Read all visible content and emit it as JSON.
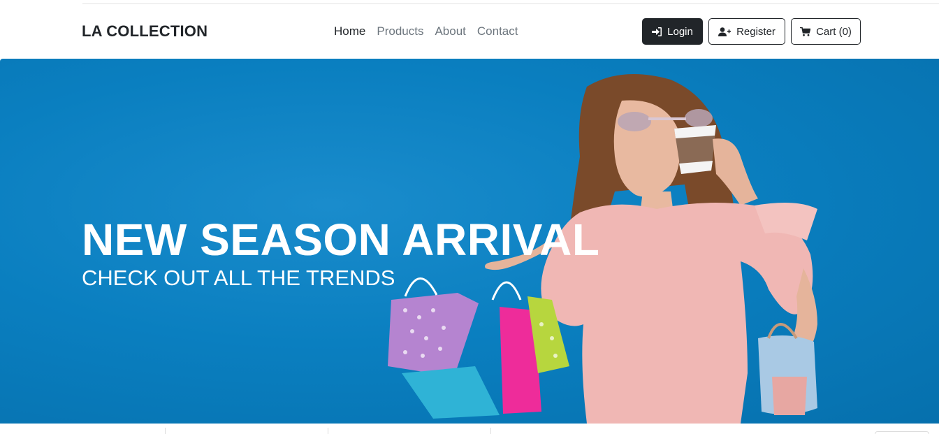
{
  "brand": "LA COLLECTION",
  "nav": {
    "links": [
      "Home",
      "Products",
      "About",
      "Contact"
    ]
  },
  "actions": {
    "login": "Login",
    "register": "Register",
    "cart": "Cart (0)"
  },
  "hero": {
    "title": "NEW SEASON ARRIVAL",
    "subtitle": "CHECK OUT ALL THE TRENDS"
  },
  "colors": {
    "hero_bg": "#0a7fc0",
    "dark_button": "#212529",
    "text_muted": "#6c757d"
  },
  "icons": {
    "login": "sign-in-icon",
    "register": "user-plus-icon",
    "cart": "shopping-cart-icon"
  }
}
